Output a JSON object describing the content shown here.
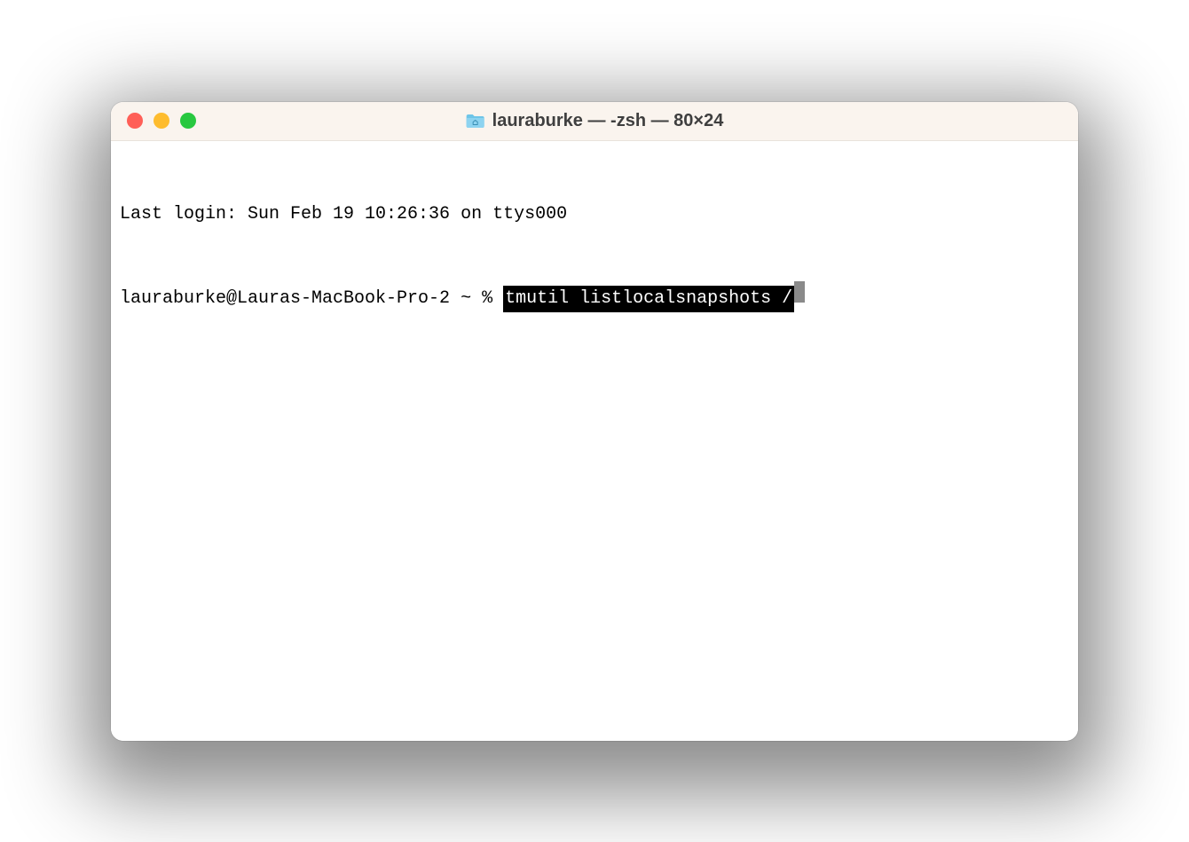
{
  "window": {
    "title": "lauraburke — -zsh — 80×24"
  },
  "terminal": {
    "last_login_line": "Last login: Sun Feb 19 10:26:36 on ttys000",
    "prompt": "lauraburke@Lauras-MacBook-Pro-2 ~ % ",
    "command": "tmutil listlocalsnapshots /"
  }
}
